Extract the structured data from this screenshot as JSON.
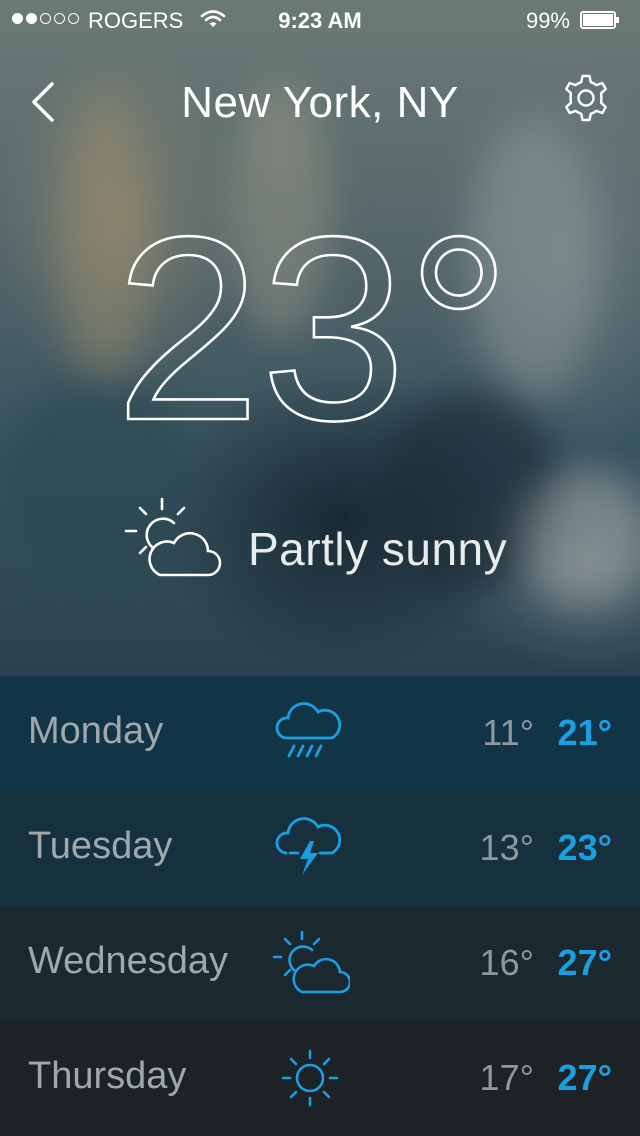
{
  "status_bar": {
    "carrier": "ROGERS",
    "time": "9:23 AM",
    "battery": "99%",
    "signal_bars_filled": 2,
    "signal_bars_total": 5
  },
  "header": {
    "city": "New York, NY",
    "back_icon": "chevron-left-icon",
    "settings_icon": "gear-icon"
  },
  "current": {
    "temperature": "23°",
    "condition": "Partly sunny",
    "condition_icon": "partly-sunny-icon"
  },
  "forecast": [
    {
      "day": "Monday",
      "icon": "rain-icon",
      "low": "11°",
      "high": "21°",
      "row_color": "#123447"
    },
    {
      "day": "Tuesday",
      "icon": "thunderstorm-icon",
      "low": "13°",
      "high": "23°",
      "row_color": "#17303d"
    },
    {
      "day": "Wednesday",
      "icon": "partly-sunny-icon",
      "low": "16°",
      "high": "27°",
      "row_color": "#1a2830"
    },
    {
      "day": "Thursday",
      "icon": "sunny-icon",
      "low": "17°",
      "high": "27°",
      "row_color": "#1d2226"
    }
  ],
  "colors": {
    "accent": "#1aa0e2",
    "text_muted": "#9fa8ac"
  }
}
